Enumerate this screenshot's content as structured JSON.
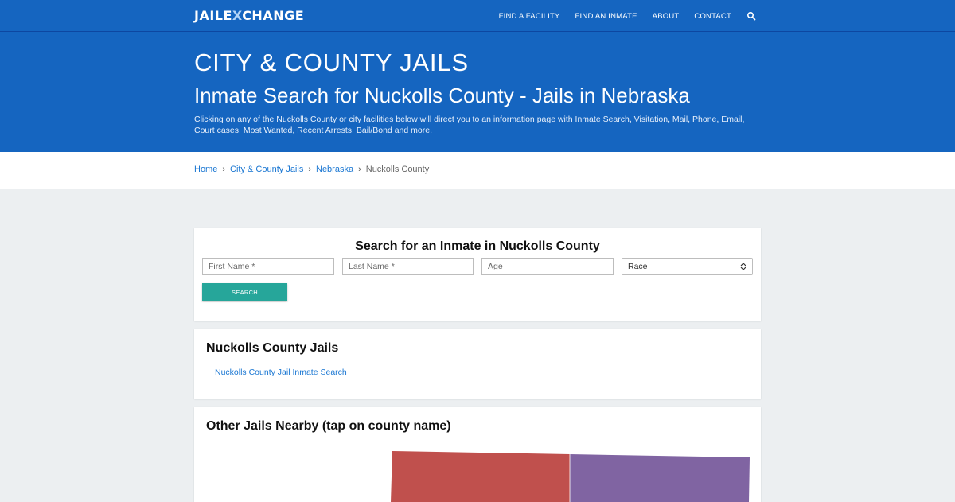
{
  "nav": {
    "logo_part1": "JAIL",
    "logo_part2": "E",
    "logo_part3": "X",
    "logo_part4": "CHANGE",
    "links": [
      "FIND A FACILITY",
      "FIND AN INMATE",
      "ABOUT",
      "CONTACT"
    ],
    "search_icon": "search-icon"
  },
  "hero": {
    "kicker": "CITY & COUNTY JAILS",
    "title": "Inmate Search for Nuckolls County - Jails in Nebraska",
    "description": "Clicking on any of the Nuckolls County or city facilities below will direct you to an information page with Inmate Search, Visitation, Mail, Phone, Email, Court cases, Most Wanted, Recent Arrests, Bail/Bond and more."
  },
  "breadcrumb": {
    "items": [
      "Home",
      "City & County Jails",
      "Nebraska"
    ],
    "current": "Nuckolls County",
    "separator_icon": "chevron-right-icon"
  },
  "search_form": {
    "heading": "Search for an Inmate in Nuckolls County",
    "first_name_placeholder": "First Name *",
    "last_name_placeholder": "Last Name *",
    "age_placeholder": "Age",
    "race_selected": "Race",
    "button_label": "SEARCH"
  },
  "jails_card": {
    "title": "Nuckolls County Jails",
    "link": "Nuckolls County Jail Inmate Search"
  },
  "nearby_card": {
    "title": "Other Jails Nearby (tap on county name)",
    "map_colors": [
      "#c0504d",
      "#8064a2"
    ]
  },
  "colors": {
    "brand_blue": "#1565c0",
    "link_blue": "#1976d2",
    "button_teal": "#26a69a",
    "page_bg": "#eceff1"
  }
}
